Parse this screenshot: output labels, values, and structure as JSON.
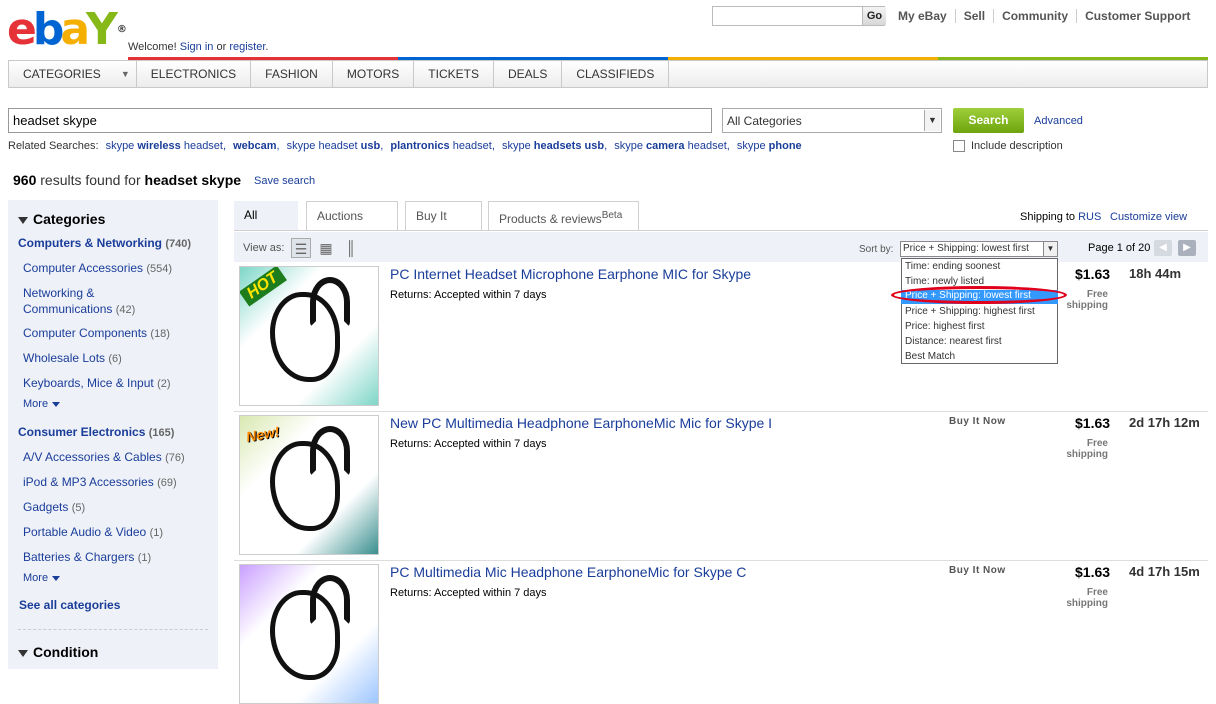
{
  "header": {
    "logo": {
      "e": "e",
      "b": "b",
      "a": "a",
      "y": "Y",
      "reg": "®"
    },
    "welcome": {
      "prefix": "Welcome! ",
      "sign_in": "Sign in",
      "or": " or ",
      "register": "register",
      "suffix": "."
    },
    "top_search_value": "",
    "go_label": "Go",
    "links": [
      "My eBay",
      "Sell",
      "Community",
      "Customer Support"
    ]
  },
  "nav": {
    "categories": "CATEGORIES",
    "items": [
      "ELECTRONICS",
      "FASHION",
      "MOTORS",
      "TICKETS",
      "DEALS",
      "CLASSIFIEDS"
    ]
  },
  "search": {
    "query": "headset skype",
    "category": "All Categories",
    "button": "Search",
    "advanced": "Advanced",
    "include_description": "Include description",
    "related_label": "Related Searches:",
    "related": [
      {
        "plain1": "skype ",
        "bold": "wireless",
        "plain2": " headset,"
      },
      {
        "plain1": "",
        "bold": "webcam",
        "plain2": ","
      },
      {
        "plain1": "skype headset ",
        "bold": "usb",
        "plain2": ","
      },
      {
        "plain1": "",
        "bold": "plantronics",
        "plain2": " headset,"
      },
      {
        "plain1": "skype ",
        "bold": "headsets usb",
        "plain2": ","
      },
      {
        "plain1": "skype ",
        "bold": "camera",
        "plain2": " headset,"
      },
      {
        "plain1": "skype ",
        "bold": "phone",
        "plain2": ""
      }
    ]
  },
  "results": {
    "count": "960",
    "mid": " results found for ",
    "query": "headset skype",
    "save": "Save search"
  },
  "sidebar": {
    "categories_title": "Categories",
    "groups": [
      {
        "name": "Computers & Networking",
        "count": "(740)"
      },
      {
        "name": "Consumer Electronics",
        "count": "(165)"
      }
    ],
    "items": [
      {
        "name": "Computer Accessories",
        "count": "(554)"
      },
      {
        "name": "Networking &",
        "name2": "Communications",
        "count": "(42)"
      },
      {
        "name": "Computer Components",
        "count": "(18)"
      },
      {
        "name": "Wholesale Lots",
        "count": "(6)"
      },
      {
        "name": "Keyboards, Mice & Input",
        "count": "(2)"
      },
      {
        "name": "A/V Accessories & Cables",
        "count": "(76)"
      },
      {
        "name": "iPod & MP3 Accessories",
        "count": "(69)"
      },
      {
        "name": "Gadgets",
        "count": "(5)"
      },
      {
        "name": "Portable Audio & Video",
        "count": "(1)"
      },
      {
        "name": "Batteries & Chargers",
        "count": "(1)"
      }
    ],
    "more": "More",
    "see_all": "See all categories",
    "condition_title": "Condition"
  },
  "tabs": [
    {
      "label": "All items"
    },
    {
      "label": "Auctions only"
    },
    {
      "label": "Buy It Now"
    },
    {
      "label": "Products & reviews",
      "sup": "Beta"
    }
  ],
  "toolbar": {
    "shipping_prefix": "Shipping to ",
    "shipping_country": "RUS",
    "customize": "Customize view",
    "view_as": "View as:",
    "sort_by": "Sort by:",
    "sort_value": "Price + Shipping: lowest first",
    "page_info": "Page 1 of 20"
  },
  "sort_options": [
    "Time: ending soonest",
    "Time: newly listed",
    "Price + Shipping: lowest first",
    "Price + Shipping: highest first",
    "Price: highest first",
    "Distance: nearest first",
    "Best Match"
  ],
  "listings": [
    {
      "title": "PC Internet Headset Microphone Earphone MIC for Skype",
      "returns": "Returns: Accepted within 7 days",
      "format": "",
      "price": "$1.63",
      "shipping1": "Free",
      "shipping2": "shipping",
      "time_left": "18h 44m",
      "badge": "HOT"
    },
    {
      "title": "New PC Multimedia Headphone EarphoneMic Mic for Skype I",
      "returns": "Returns: Accepted within 7 days",
      "format": "Buy It Now",
      "price": "$1.63",
      "shipping1": "Free",
      "shipping2": "shipping",
      "time_left": "2d 17h 12m",
      "badge": "New!"
    },
    {
      "title": "PC Multimedia Mic Headphone EarphoneMic for Skype C",
      "returns": "Returns: Accepted within 7 days",
      "format": "Buy It Now",
      "price": "$1.63",
      "shipping1": "Free",
      "shipping2": "shipping",
      "time_left": "4d 17h 15m",
      "badge": ""
    }
  ]
}
